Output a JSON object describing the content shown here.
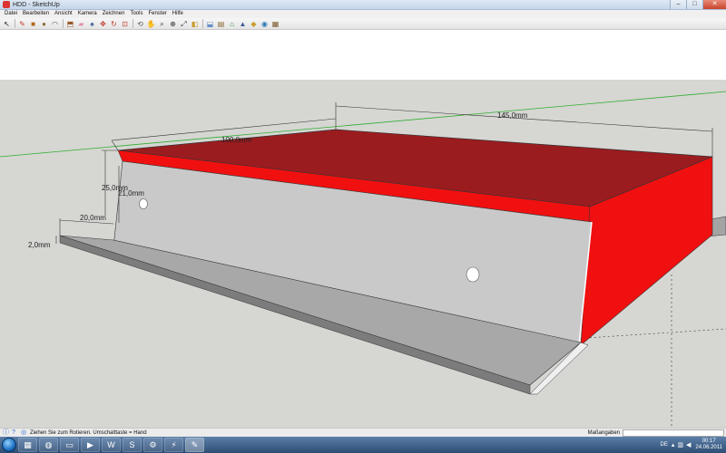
{
  "window": {
    "title": "HDD - SketchUp",
    "minimize": "–",
    "maximize": "□",
    "close": "✕"
  },
  "menu": [
    "Datei",
    "Bearbeiten",
    "Ansicht",
    "Kamera",
    "Zeichnen",
    "Tools",
    "Fenster",
    "Hilfe"
  ],
  "toolbar": {
    "icons": [
      {
        "name": "select-icon",
        "glyph": "↖",
        "color": "#222"
      },
      {
        "name": "pencil-icon",
        "glyph": "✎",
        "color": "#c0392b"
      },
      {
        "name": "rectangle-icon",
        "glyph": "■",
        "color": "#b5651d"
      },
      {
        "name": "circle-icon",
        "glyph": "●",
        "color": "#8b6d3a"
      },
      {
        "name": "arc-icon",
        "glyph": "◠",
        "color": "#555"
      },
      {
        "name": "push-pull-icon",
        "glyph": "⬒",
        "color": "#9a5b2a"
      },
      {
        "name": "eraser-icon",
        "glyph": "▰",
        "color": "#e091b3"
      },
      {
        "name": "paint-bucket-icon",
        "glyph": "♠",
        "color": "#3c5d9a"
      },
      {
        "name": "move-icon",
        "glyph": "✥",
        "color": "#c0392b"
      },
      {
        "name": "rotate-icon",
        "glyph": "↻",
        "color": "#c0392b"
      },
      {
        "name": "offset-icon",
        "glyph": "⊡",
        "color": "#c0392b"
      },
      {
        "name": "orbit-icon",
        "glyph": "⟲",
        "color": "#555"
      },
      {
        "name": "pan-icon",
        "glyph": "✋",
        "color": "#b07a3b"
      },
      {
        "name": "zoom-icon",
        "glyph": "⌕",
        "color": "#333"
      },
      {
        "name": "zoom-window-icon",
        "glyph": "⊕",
        "color": "#333"
      },
      {
        "name": "zoom-extents-icon",
        "glyph": "⤢",
        "color": "#333"
      },
      {
        "name": "previous-view-icon",
        "glyph": "◧",
        "color": "#c79a2a"
      },
      {
        "name": "section-plane-icon",
        "glyph": "⬓",
        "color": "#6a8fc8"
      },
      {
        "name": "component-icon",
        "glyph": "▤",
        "color": "#8b6d3a"
      },
      {
        "name": "warehouse-icon",
        "glyph": "⌂",
        "color": "#3a8a3a"
      },
      {
        "name": "upload-icon",
        "glyph": "▲",
        "color": "#3c5d9a"
      },
      {
        "name": "styles-icon",
        "glyph": "◆",
        "color": "#c79a2a"
      },
      {
        "name": "extension-icon",
        "glyph": "◉",
        "color": "#2a7ab8"
      },
      {
        "name": "layers-icon",
        "glyph": "▦",
        "color": "#7a5b2a"
      }
    ]
  },
  "dimensions": {
    "top_width": "145,0mm",
    "top_depth": "100,0mm",
    "side_height": "25,0mm",
    "inner_height": "21,0mm",
    "flange_depth": "20,0mm",
    "thickness": "2,0mm"
  },
  "colors": {
    "sky": "#ffffff",
    "ground": "#d6d6d3",
    "top_face": "#9b1c1f",
    "red_face": "#f01010",
    "grey_front": "#c9c9c9",
    "grey_floor": "#a8a8a8",
    "axis_green": "#2fae2f"
  },
  "status": {
    "text": "Ziehen Sie zum Rotieren.  Umschalttaste = Hand",
    "measure_label": "Maßangaben"
  },
  "taskbar": {
    "apps": [
      {
        "name": "explorer-icon",
        "glyph": "▦"
      },
      {
        "name": "firefox-icon",
        "glyph": "◍"
      },
      {
        "name": "folder-icon",
        "glyph": "▭"
      },
      {
        "name": "media-player-icon",
        "glyph": "▶"
      },
      {
        "name": "word-icon",
        "glyph": "W"
      },
      {
        "name": "skype-icon",
        "glyph": "S"
      },
      {
        "name": "steam-icon",
        "glyph": "⚙"
      },
      {
        "name": "filezilla-icon",
        "glyph": "⚡"
      },
      {
        "name": "sketchup-icon",
        "glyph": "✎"
      }
    ],
    "active_index": 8,
    "language": "DE",
    "clock_time": "00:17",
    "clock_date": "24.06.2011"
  }
}
